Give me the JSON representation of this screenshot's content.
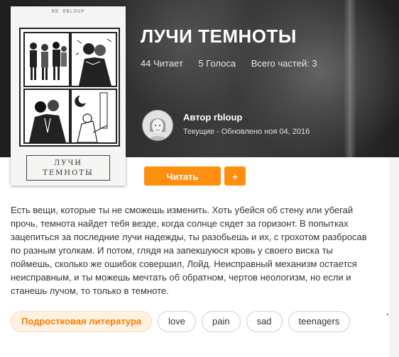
{
  "story": {
    "title": "ЛУЧИ ТЕМНОТЫ",
    "stats": {
      "reads": "44 Читает",
      "votes": "5 Голоса",
      "parts": "Всего частей: 3"
    },
    "author": {
      "name": "Автор rbloup",
      "meta": "Текущие - Обновлено ноя 04, 2016"
    },
    "cover": {
      "author_text": "RB RBLOUP",
      "title_text": "ЛУЧИ ТЕМНОТЫ"
    },
    "buttons": {
      "read": "Читать",
      "add": "+"
    },
    "description": "Есть вещи, которые ты не сможешь изменить. Хоть убейся об стену или убегай прочь, темнота найдет тебя везде, когда солнце сядет за горизонт. В попытках зацепиться за последние лучи надежды, ты разобьешь и их, с грохотом разбросав по разным уголкам. И потом, глядя на запекшуюся кровь у своего виска ты поймешь, сколько же ошибок совершил, Лойд. Неисправный механизм остается неисправным, и ты можешь мечтать об обратном, чертов неологизм, но если и станешь лучом, то только в темноте.",
    "tags": [
      "Подростковая литература",
      "love",
      "pain",
      "sad",
      "teenagers"
    ]
  },
  "colors": {
    "accent": "#ff8f0f",
    "tag_primary_bg": "#fff2e3",
    "tag_primary_text": "#ff7a00"
  }
}
